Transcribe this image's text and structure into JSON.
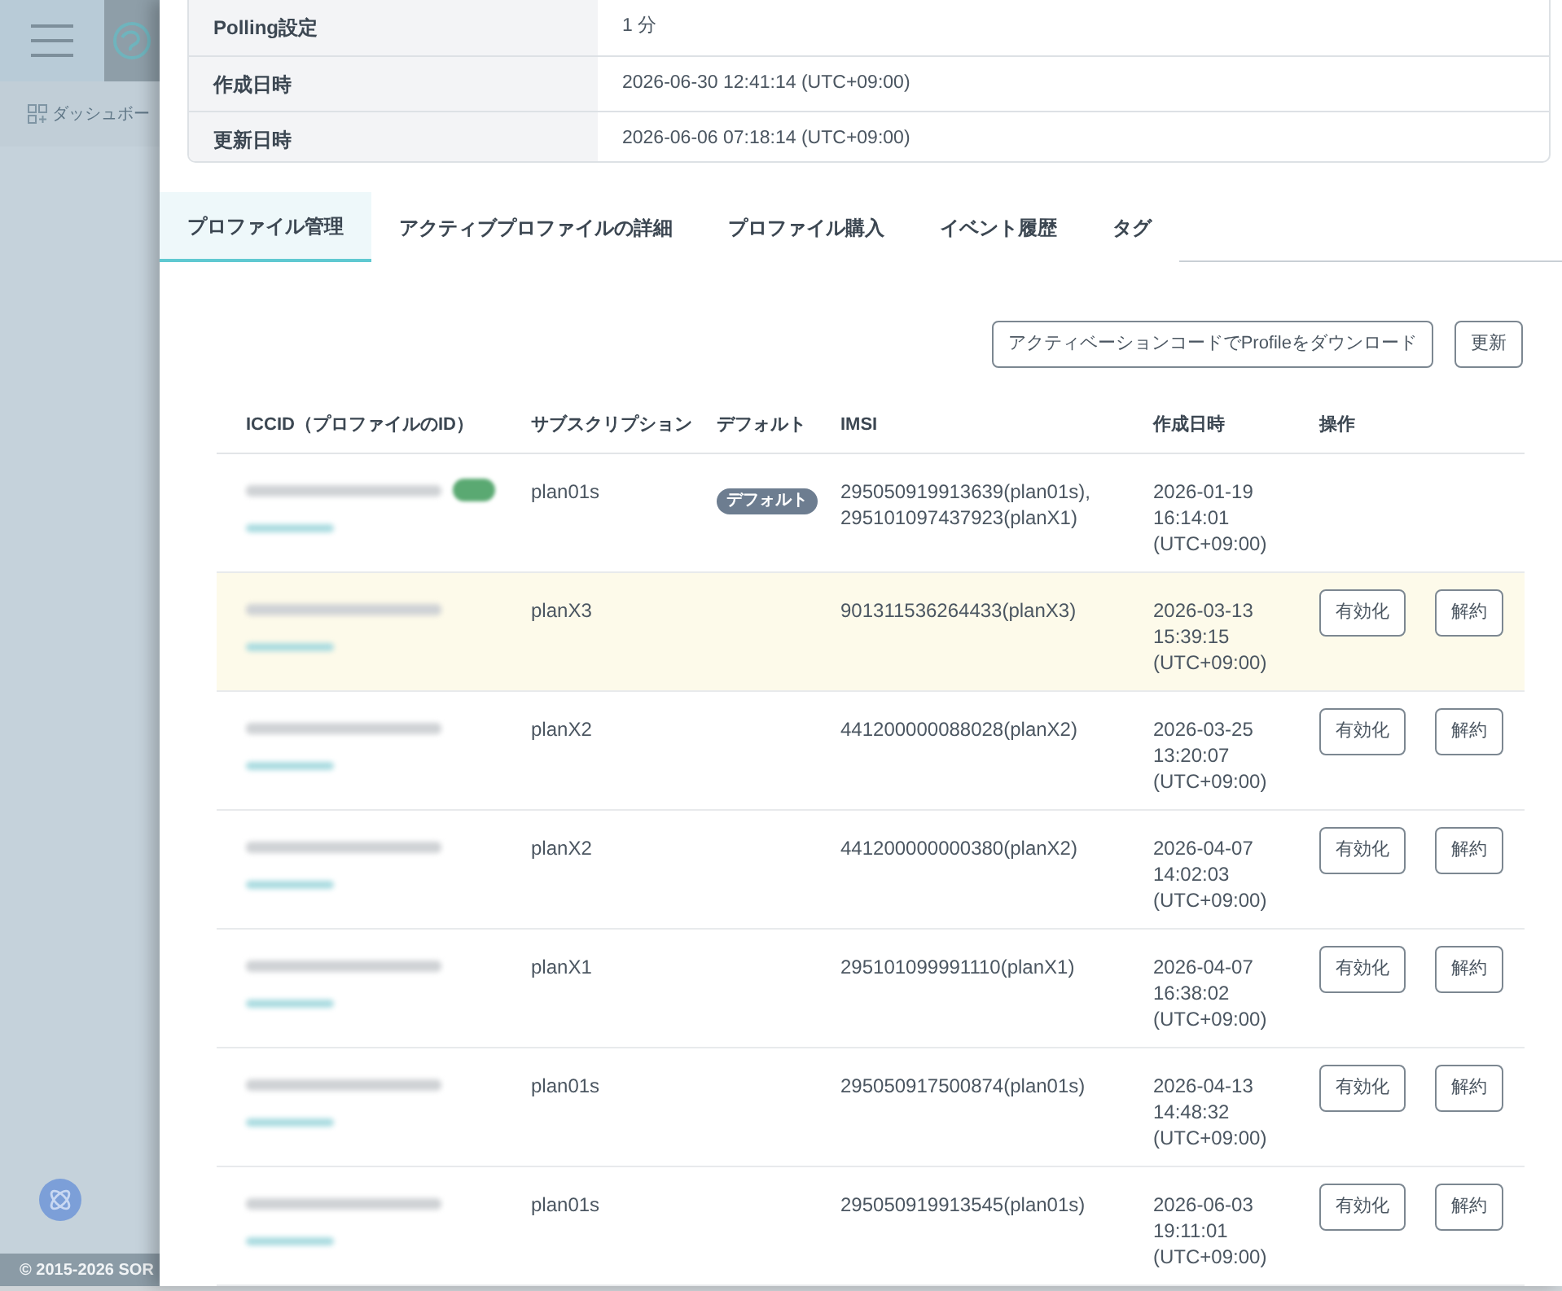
{
  "sidebar": {
    "menu_items": [
      {
        "label": "ダッシュボー"
      }
    ],
    "footer": "© 2015-2026 SOR"
  },
  "info_table": [
    {
      "label": "Polling設定",
      "value": "1 分"
    },
    {
      "label": "作成日時",
      "value": "2026-06-30 12:41:14 (UTC+09:00)"
    },
    {
      "label": "更新日時",
      "value": "2026-06-06 07:18:14 (UTC+09:00)"
    }
  ],
  "tabs": [
    {
      "label": "プロファイル管理",
      "selected": true
    },
    {
      "label": "アクティブプロファイルの詳細",
      "selected": false
    },
    {
      "label": "プロファイル購入",
      "selected": false
    },
    {
      "label": "イベント履歴",
      "selected": false
    },
    {
      "label": "タグ",
      "selected": false
    }
  ],
  "actions": [
    "アクティベーションコードでProfileをダウンロード",
    "更新"
  ],
  "profiles": {
    "columns": [
      "ICCID（プロファイルのID）",
      "サブスクリプション",
      "デフォルト",
      "IMSI",
      "作成日時",
      "操作"
    ],
    "rows": [
      {
        "highlighted": false,
        "status_badge": true,
        "subscription": "plan01s",
        "default": "デフォルト",
        "imsi": "295050919913639(plan01s), 295101097437923(planX1)",
        "created": "2026-01-19 16:14:01 (UTC+09:00)"
      },
      {
        "highlighted": true,
        "status_badge": false,
        "subscription": "planX3",
        "imsi": "901311536264433(planX3)",
        "created": "2026-03-13 15:39:15 (UTC+09:00)",
        "buttons": [
          "有効化",
          "解約"
        ]
      },
      {
        "highlighted": false,
        "status_badge": false,
        "subscription": "planX2",
        "imsi": "441200000088028(planX2)",
        "created": "2026-03-25 13:20:07 (UTC+09:00)",
        "buttons": [
          "有効化",
          "解約"
        ]
      },
      {
        "highlighted": false,
        "status_badge": false,
        "subscription": "planX2",
        "imsi": "441200000000380(planX2)",
        "created": "2026-04-07 14:02:03 (UTC+09:00)",
        "buttons": [
          "有効化",
          "解約"
        ]
      },
      {
        "highlighted": false,
        "status_badge": false,
        "subscription": "planX1",
        "imsi": "295101099991110(planX1)",
        "created": "2026-04-07 16:38:02 (UTC+09:00)",
        "buttons": [
          "有効化",
          "解約"
        ]
      },
      {
        "highlighted": false,
        "status_badge": false,
        "subscription": "plan01s",
        "imsi": "295050917500874(plan01s)",
        "created": "2026-04-13 14:48:32 (UTC+09:00)",
        "buttons": [
          "有効化",
          "解約"
        ]
      },
      {
        "highlighted": false,
        "status_badge": false,
        "subscription": "plan01s",
        "imsi": "295050919913545(plan01s)",
        "created": "2026-06-03 19:11:01 (UTC+09:00)",
        "buttons": [
          "有効化",
          "解約"
        ]
      }
    ]
  }
}
